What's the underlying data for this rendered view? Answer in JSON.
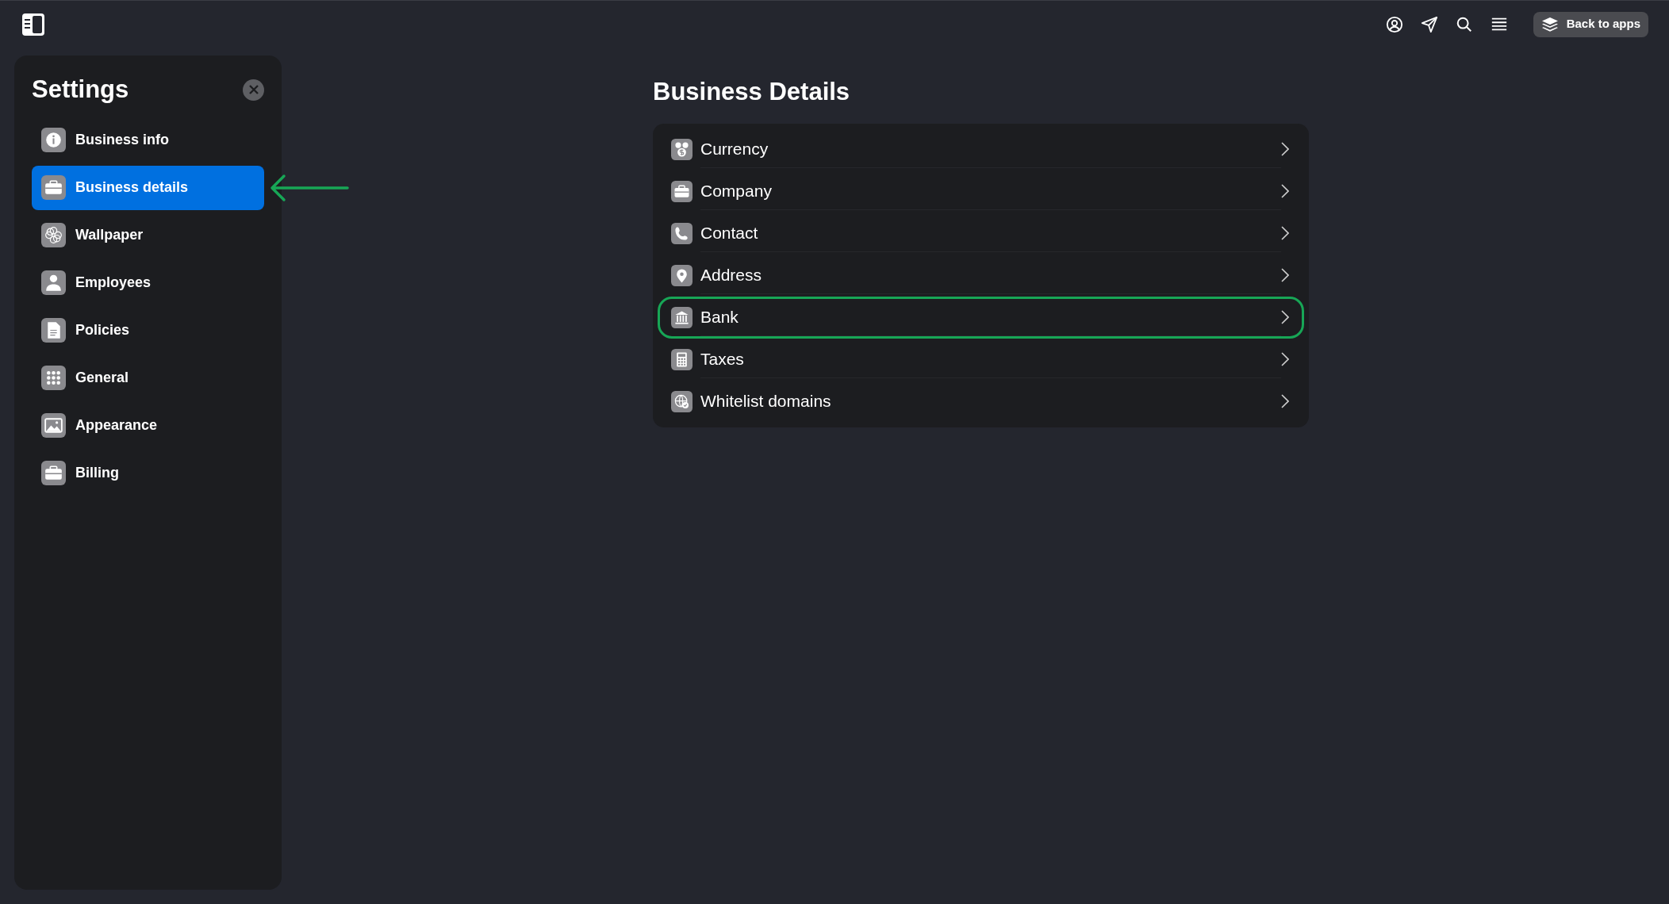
{
  "topbar": {
    "back_button": "Back to apps"
  },
  "sidebar": {
    "title": "Settings",
    "items": [
      {
        "label": "Business info",
        "selected": false,
        "annotated": false
      },
      {
        "label": "Business details",
        "selected": true,
        "annotated": true
      },
      {
        "label": "Wallpaper",
        "selected": false,
        "annotated": false
      },
      {
        "label": "Employees",
        "selected": false,
        "annotated": false
      },
      {
        "label": "Policies",
        "selected": false,
        "annotated": false
      },
      {
        "label": "General",
        "selected": false,
        "annotated": false
      },
      {
        "label": "Appearance",
        "selected": false,
        "annotated": false
      },
      {
        "label": "Billing",
        "selected": false,
        "annotated": false
      }
    ]
  },
  "main": {
    "title": "Business Details",
    "rows": [
      {
        "label": "Currency",
        "highlighted": false
      },
      {
        "label": "Company",
        "highlighted": false
      },
      {
        "label": "Contact",
        "highlighted": false
      },
      {
        "label": "Address",
        "highlighted": false
      },
      {
        "label": "Bank",
        "highlighted": true
      },
      {
        "label": "Taxes",
        "highlighted": false
      },
      {
        "label": "Whitelist domains",
        "highlighted": false
      }
    ]
  }
}
